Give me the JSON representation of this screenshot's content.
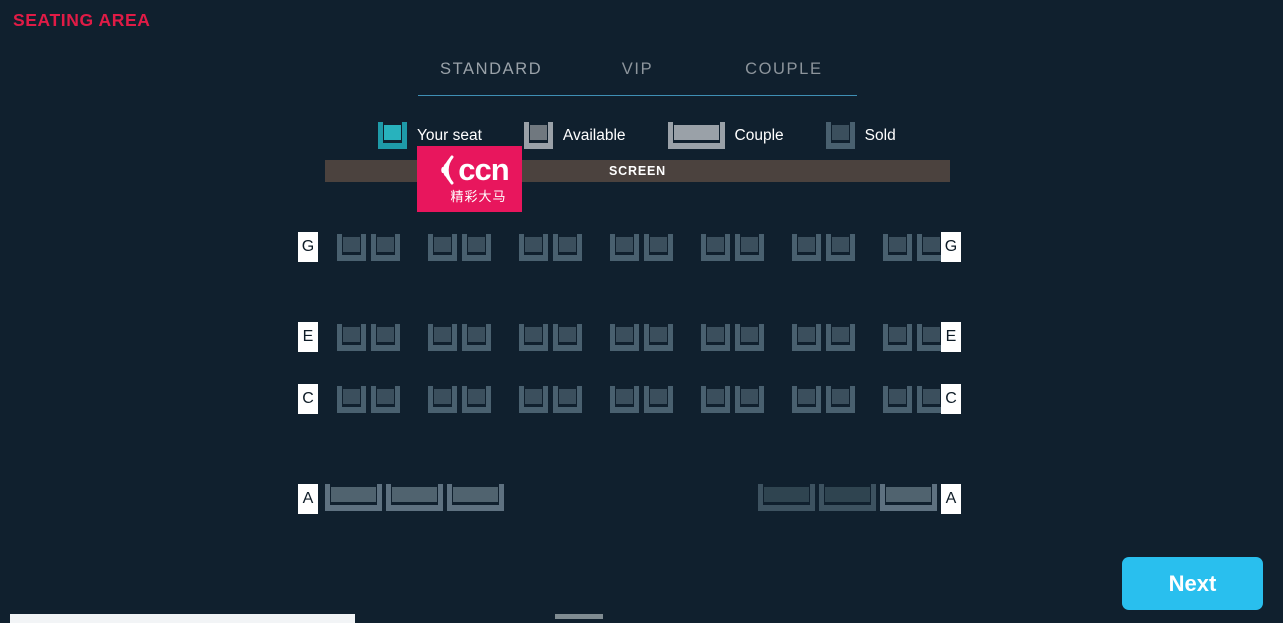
{
  "header": {
    "title": "SEATING AREA",
    "title_color": "#e01b46"
  },
  "tabs": [
    {
      "label": "STANDARD",
      "active": true
    },
    {
      "label": "VIP",
      "active": false
    },
    {
      "label": "COUPLE",
      "active": false
    }
  ],
  "tab_underline_color": "#3f8fb5",
  "legend": [
    {
      "label": "Your seat",
      "icon": "seat-icon",
      "color": "#28b2bd"
    },
    {
      "label": "Available",
      "icon": "seat-icon",
      "color": "#9aa1a8"
    },
    {
      "label": "Couple",
      "icon": "couple-seat-icon",
      "color": "#9aa1a8"
    },
    {
      "label": "Sold",
      "icon": "seat-icon",
      "color": "#49606f"
    }
  ],
  "screen": {
    "label": "SCREEN",
    "bar_color": "#4b423e"
  },
  "logo": {
    "text": "ccn",
    "subtext": "精彩大马",
    "background": "#e8165d"
  },
  "seatmap": {
    "rows": [
      {
        "label": "G",
        "type": "standard",
        "groups": 7,
        "seats_per_group": 2,
        "state": "sold"
      },
      {
        "label": "E",
        "type": "standard",
        "groups": 7,
        "seats_per_group": 2,
        "state": "sold"
      },
      {
        "label": "C",
        "type": "standard",
        "groups": 7,
        "seats_per_group": 2,
        "state": "sold"
      },
      {
        "label": "A",
        "type": "couple",
        "left_seats": 3,
        "right_seats": 3,
        "state": "sold"
      }
    ]
  },
  "actions": {
    "next_label": "Next",
    "next_color": "#29bfee"
  }
}
